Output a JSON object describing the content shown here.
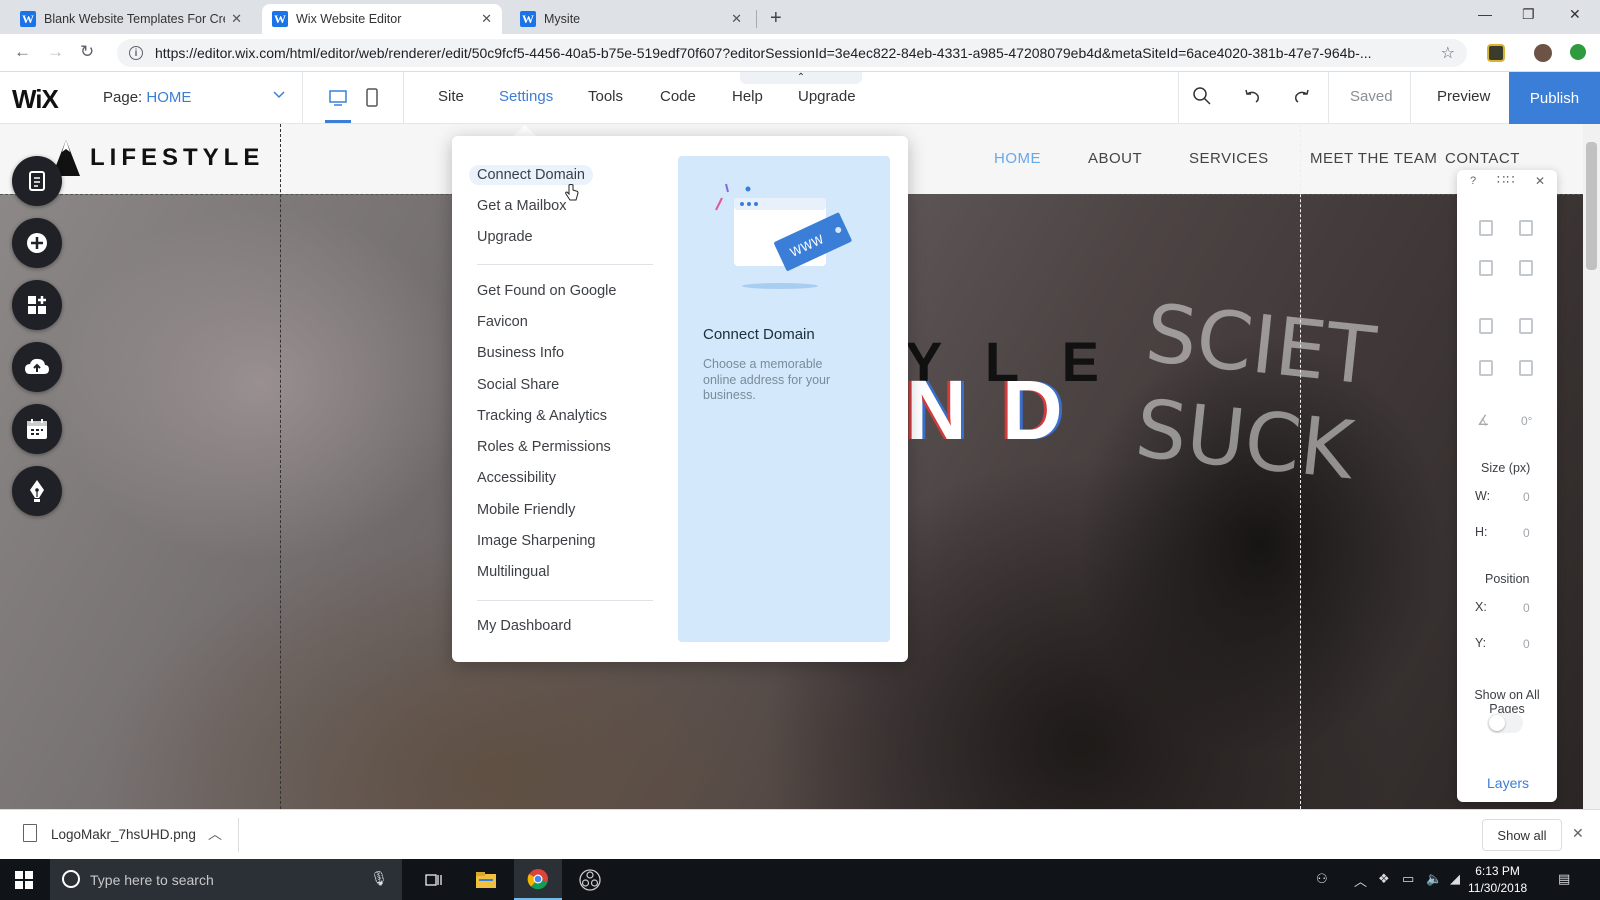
{
  "browser": {
    "tabs": [
      {
        "label": "Blank Website Templates For Cre",
        "active": false
      },
      {
        "label": "Wix Website Editor",
        "active": true
      },
      {
        "label": "Mysite",
        "active": false
      }
    ],
    "url": "https://editor.wix.com/html/editor/web/renderer/edit/50c9fcf5-4456-40a5-b75e-519edf70f607?editorSessionId=3e4ec822-84eb-4331-a985-47208079eb4d&metaSiteId=6ace4020-381b-47e7-964b-..."
  },
  "wix": {
    "logo": "WiX",
    "page_label": "Page:",
    "page_value": "HOME",
    "menu": [
      {
        "label": "Site",
        "active": false
      },
      {
        "label": "Settings",
        "active": true
      },
      {
        "label": "Tools",
        "active": false
      },
      {
        "label": "Code",
        "active": false
      },
      {
        "label": "Help",
        "active": false
      },
      {
        "label": "Upgrade",
        "active": false
      }
    ],
    "saved": "Saved",
    "preview": "Preview",
    "publish": "Publish",
    "accent": "#3b7ed8"
  },
  "site": {
    "logo_text": "LIFESTYLE",
    "nav": [
      {
        "label": "HOME",
        "active": true
      },
      {
        "label": "ABOUT",
        "active": false
      },
      {
        "label": "SERVICES",
        "active": false
      },
      {
        "label": "MEET THE TEAM",
        "active": false
      },
      {
        "label": "CONTACT",
        "active": false
      }
    ],
    "hero_line1": "Y L E",
    "hero_line2": "N D",
    "chalk": "SCIET SUCK"
  },
  "settings_menu": {
    "group1": [
      "Connect Domain",
      "Get a Mailbox",
      "Upgrade"
    ],
    "group2": [
      "Get Found on Google",
      "Favicon",
      "Business Info",
      "Social Share",
      "Tracking & Analytics",
      "Roles & Permissions",
      "Accessibility",
      "Mobile Friendly",
      "Image Sharpening",
      "Multilingual"
    ],
    "group3": [
      "My Dashboard"
    ],
    "promo_badge": "WWW",
    "promo_title": "Connect Domain",
    "promo_desc": "Choose a memorable online address for your business."
  },
  "property_panel": {
    "help": "?",
    "rotation": "0°",
    "size_label": "Size (px)",
    "w_label": "W:",
    "w_value": "0",
    "h_label": "H:",
    "h_value": "0",
    "position_label": "Position",
    "x_label": "X:",
    "x_value": "0",
    "y_label": "Y:",
    "y_value": "0",
    "show_all_pages": "Show on All Pages",
    "layers": "Layers"
  },
  "download": {
    "filename": "LogoMakr_7hsUHD.png",
    "show_all": "Show all"
  },
  "taskbar": {
    "search_placeholder": "Type here to search",
    "time": "6:13 PM",
    "date": "11/30/2018"
  }
}
